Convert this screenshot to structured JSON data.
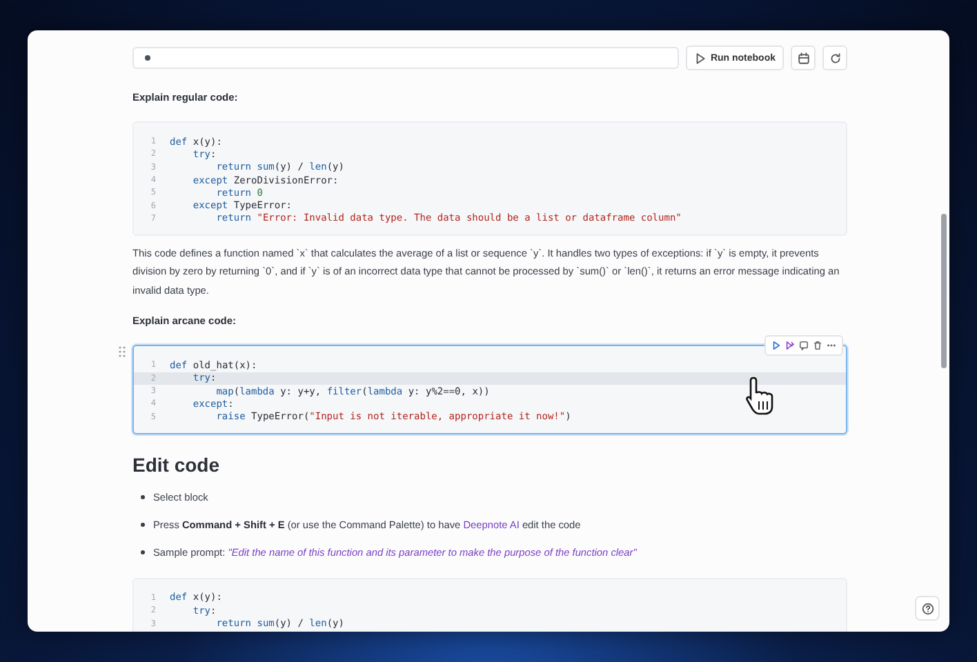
{
  "top_bar": {
    "run_button": "Run notebook"
  },
  "content": [
    {
      "kind": "label",
      "text": "Explain regular code:"
    },
    {
      "kind": "code",
      "selected": false,
      "lines": [
        {
          "number": "1",
          "active": false,
          "tokens": [
            {
              "kind": "keyword",
              "text": "def"
            },
            {
              "kind": "plain",
              "text": " x(y):"
            }
          ]
        },
        {
          "number": "2",
          "active": false,
          "tokens": [
            {
              "kind": "keyword",
              "text": "    try"
            },
            {
              "kind": "plain",
              "text": ":"
            }
          ]
        },
        {
          "number": "3",
          "active": false,
          "tokens": [
            {
              "kind": "keyword",
              "text": "        return"
            },
            {
              "kind": "builtin",
              "text": " sum"
            },
            {
              "kind": "plain",
              "text": "(y) / "
            },
            {
              "kind": "builtin",
              "text": "len"
            },
            {
              "kind": "plain",
              "text": "(y)"
            }
          ]
        },
        {
          "number": "4",
          "active": false,
          "tokens": [
            {
              "kind": "keyword",
              "text": "    except"
            },
            {
              "kind": "plain",
              "text": " ZeroDivisionError:"
            }
          ]
        },
        {
          "number": "5",
          "active": false,
          "tokens": [
            {
              "kind": "keyword",
              "text": "        return"
            },
            {
              "kind": "number",
              "text": " 0"
            }
          ]
        },
        {
          "number": "6",
          "active": false,
          "tokens": [
            {
              "kind": "keyword",
              "text": "    except"
            },
            {
              "kind": "plain",
              "text": " TypeError:"
            }
          ]
        },
        {
          "number": "7",
          "active": false,
          "tokens": [
            {
              "kind": "keyword",
              "text": "        return"
            },
            {
              "kind": "string",
              "text": " \"Error: Invalid data type. The data should be a list or dataframe column\""
            }
          ]
        }
      ]
    },
    {
      "kind": "paragraph",
      "text": "This code defines a function named `x` that calculates the average of a list or sequence `y`. It handles two types of exceptions: if `y` is empty, it prevents division by zero by returning `0`, and if `y` is of an incorrect data type that cannot be processed by `sum()` or `len()`, it returns an error message indicating an invalid data type."
    },
    {
      "kind": "label",
      "text": "Explain arcane code:"
    },
    {
      "kind": "code",
      "selected": true,
      "lines": [
        {
          "number": "1",
          "active": false,
          "tokens": [
            {
              "kind": "keyword",
              "text": "def"
            },
            {
              "kind": "plain",
              "text": " old_hat(x):"
            }
          ]
        },
        {
          "number": "2",
          "active": true,
          "tokens": [
            {
              "kind": "keyword",
              "text": "    try"
            },
            {
              "kind": "plain",
              "text": ":"
            }
          ]
        },
        {
          "number": "3",
          "active": false,
          "tokens": [
            {
              "kind": "builtin",
              "text": "        map"
            },
            {
              "kind": "plain",
              "text": "("
            },
            {
              "kind": "keyword",
              "text": "lambda"
            },
            {
              "kind": "plain",
              "text": " y: y+y, "
            },
            {
              "kind": "builtin",
              "text": "filter"
            },
            {
              "kind": "plain",
              "text": "("
            },
            {
              "kind": "keyword",
              "text": "lambda"
            },
            {
              "kind": "plain",
              "text": " y: y%2==0, x))"
            }
          ]
        },
        {
          "number": "4",
          "active": false,
          "tokens": [
            {
              "kind": "keyword",
              "text": "    except"
            },
            {
              "kind": "plain",
              "text": ":"
            }
          ]
        },
        {
          "number": "5",
          "active": false,
          "tokens": [
            {
              "kind": "keyword",
              "text": "        raise"
            },
            {
              "kind": "plain",
              "text": " TypeError("
            },
            {
              "kind": "string",
              "text": "\"Input is not iterable, appropriate it now!\""
            },
            {
              "kind": "plain",
              "text": ")"
            }
          ]
        }
      ]
    },
    {
      "kind": "heading",
      "text": "Edit code"
    },
    {
      "kind": "bullets",
      "items": [
        {
          "segments": [
            {
              "kind": "plain",
              "text": "Select block"
            }
          ]
        },
        {
          "segments": [
            {
              "kind": "plain",
              "text": "Press "
            },
            {
              "kind": "bold",
              "text": "Command + Shift + E"
            },
            {
              "kind": "plain",
              "text": " (or use the Command Palette) to have "
            },
            {
              "kind": "link",
              "text": "Deepnote AI"
            },
            {
              "kind": "plain",
              "text": " edit the code"
            }
          ]
        },
        {
          "segments": [
            {
              "kind": "plain",
              "text": "Sample prompt: "
            },
            {
              "kind": "quote",
              "text": "\"Edit the name of this function and its parameter to make the purpose of the function clear\""
            }
          ]
        }
      ]
    },
    {
      "kind": "code",
      "selected": false,
      "lines": [
        {
          "number": "1",
          "active": false,
          "tokens": [
            {
              "kind": "keyword",
              "text": "def"
            },
            {
              "kind": "plain",
              "text": " x(y):"
            }
          ]
        },
        {
          "number": "2",
          "active": false,
          "tokens": [
            {
              "kind": "keyword",
              "text": "    try"
            },
            {
              "kind": "plain",
              "text": ":"
            }
          ]
        },
        {
          "number": "3",
          "active": false,
          "tokens": [
            {
              "kind": "keyword",
              "text": "        return"
            },
            {
              "kind": "builtin",
              "text": " sum"
            },
            {
              "kind": "plain",
              "text": "(y) / "
            },
            {
              "kind": "builtin",
              "text": "len"
            },
            {
              "kind": "plain",
              "text": "(y)"
            }
          ]
        }
      ]
    }
  ]
}
